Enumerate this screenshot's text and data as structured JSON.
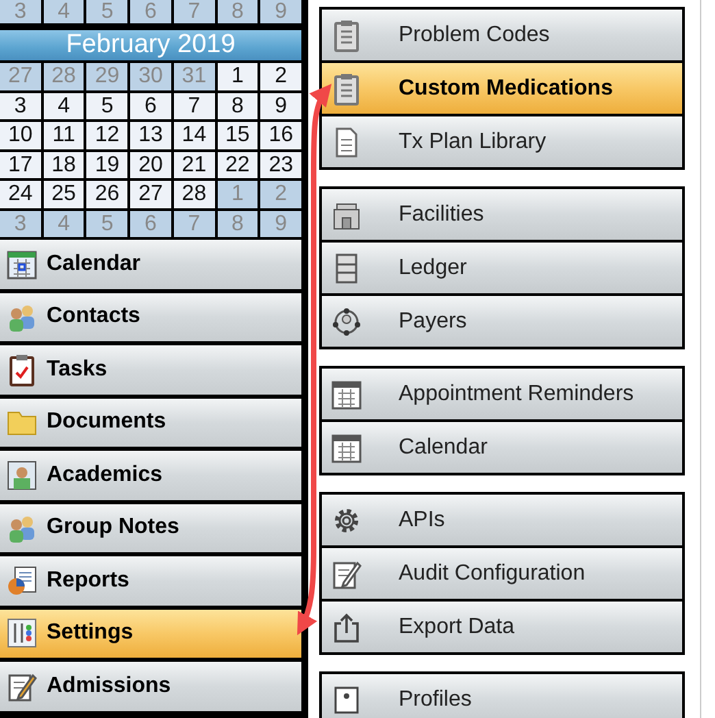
{
  "calendar": {
    "month_title": "February 2019",
    "lead_week": [
      {
        "day": "3",
        "outside": true
      },
      {
        "day": "4",
        "outside": true
      },
      {
        "day": "5",
        "outside": true
      },
      {
        "day": "6",
        "outside": true
      },
      {
        "day": "7",
        "outside": true
      },
      {
        "day": "8",
        "outside": true
      },
      {
        "day": "9",
        "outside": true
      }
    ],
    "weeks": [
      [
        {
          "day": "27",
          "outside": true
        },
        {
          "day": "28",
          "outside": true
        },
        {
          "day": "29",
          "outside": true
        },
        {
          "day": "30",
          "outside": true
        },
        {
          "day": "31",
          "outside": true
        },
        {
          "day": "1",
          "outside": false
        },
        {
          "day": "2",
          "outside": false
        }
      ],
      [
        {
          "day": "3",
          "outside": false
        },
        {
          "day": "4",
          "outside": false
        },
        {
          "day": "5",
          "outside": false
        },
        {
          "day": "6",
          "outside": false
        },
        {
          "day": "7",
          "outside": false
        },
        {
          "day": "8",
          "outside": false
        },
        {
          "day": "9",
          "outside": false
        }
      ],
      [
        {
          "day": "10",
          "outside": false
        },
        {
          "day": "11",
          "outside": false
        },
        {
          "day": "12",
          "outside": false
        },
        {
          "day": "13",
          "outside": false
        },
        {
          "day": "14",
          "outside": false
        },
        {
          "day": "15",
          "outside": false
        },
        {
          "day": "16",
          "outside": false
        }
      ],
      [
        {
          "day": "17",
          "outside": false
        },
        {
          "day": "18",
          "outside": false
        },
        {
          "day": "19",
          "outside": false
        },
        {
          "day": "20",
          "outside": false
        },
        {
          "day": "21",
          "outside": false
        },
        {
          "day": "22",
          "outside": false
        },
        {
          "day": "23",
          "outside": false
        }
      ],
      [
        {
          "day": "24",
          "outside": false
        },
        {
          "day": "25",
          "outside": false
        },
        {
          "day": "26",
          "outside": false
        },
        {
          "day": "27",
          "outside": false
        },
        {
          "day": "28",
          "outside": false
        },
        {
          "day": "1",
          "outside": true
        },
        {
          "day": "2",
          "outside": true
        }
      ],
      [
        {
          "day": "3",
          "outside": true
        },
        {
          "day": "4",
          "outside": true
        },
        {
          "day": "5",
          "outside": true
        },
        {
          "day": "6",
          "outside": true
        },
        {
          "day": "7",
          "outside": true
        },
        {
          "day": "8",
          "outside": true
        },
        {
          "day": "9",
          "outside": true
        }
      ]
    ]
  },
  "nav": [
    {
      "label": "Calendar",
      "selected": false
    },
    {
      "label": "Contacts",
      "selected": false
    },
    {
      "label": "Tasks",
      "selected": false
    },
    {
      "label": "Documents",
      "selected": false
    },
    {
      "label": "Academics",
      "selected": false
    },
    {
      "label": "Group Notes",
      "selected": false
    },
    {
      "label": "Reports",
      "selected": false
    },
    {
      "label": "Settings",
      "selected": true
    },
    {
      "label": "Admissions",
      "selected": false
    }
  ],
  "settings_groups": [
    [
      {
        "label": "Problem Codes",
        "selected": false
      },
      {
        "label": "Custom Medications",
        "selected": true
      },
      {
        "label": "Tx Plan Library",
        "selected": false
      }
    ],
    [
      {
        "label": "Facilities",
        "selected": false
      },
      {
        "label": "Ledger",
        "selected": false
      },
      {
        "label": "Payers",
        "selected": false
      }
    ],
    [
      {
        "label": "Appointment Reminders",
        "selected": false
      },
      {
        "label": "Calendar",
        "selected": false
      }
    ],
    [
      {
        "label": "APIs",
        "selected": false
      },
      {
        "label": "Audit Configuration",
        "selected": false
      },
      {
        "label": "Export Data",
        "selected": false
      }
    ],
    [
      {
        "label": "Profiles",
        "selected": false
      }
    ]
  ]
}
